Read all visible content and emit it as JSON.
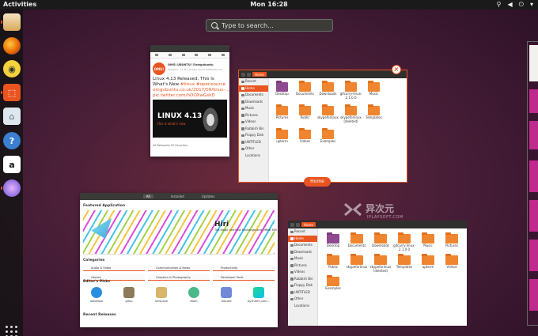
{
  "topbar": {
    "activities": "Activities",
    "clock": "Mon 16:28"
  },
  "search": {
    "placeholder": "Type to search..."
  },
  "dock": {
    "apps": [
      "files-manager-icon",
      "firefox-icon",
      "rhythmbox-icon",
      "software-icon",
      "trash-icon",
      "help-icon",
      "amazon-icon",
      "app-icon"
    ]
  },
  "tweet": {
    "handle": "OMG! UBUNTU! @omgubuntu",
    "date": "09/28/17, 17:46 | Tweets about @OMGUbuntu",
    "text_main": "Linux 4.13 Released, This Is What's New ",
    "tags": "#linux #opensource",
    "link": " omgubuntu.co.uk/2017/09/linux-... pic.twitter.com/hOOXwGskD",
    "image_title": "LINUX 4.13",
    "image_sub": "this is what's new",
    "logo": "OMG!",
    "footer": "46 Retweets  29 Favorites"
  },
  "file_manager": {
    "path": "Home",
    "sidebar": [
      "Recent",
      "Home",
      "Documents",
      "Downloads",
      "Music",
      "Pictures",
      "Videos",
      "Rubbish Bin",
      "Floppy Disk",
      "UNTITLED",
      "Other Locations"
    ],
    "items": [
      "Desktop",
      "Documents",
      "Downloads",
      "gifcurry-linux-2.1.0.0",
      "Music",
      "Pictures",
      "Public",
      "skypeforlinux",
      "skypeforlinux (deleted)",
      "Templates",
      "upterm",
      "Videos",
      "Examples"
    ],
    "items_secondary": [
      "Desktop",
      "Documents",
      "Downloads",
      "gifcurry-linux-2.1.0.0",
      "Music",
      "Pictures",
      "Public",
      "skypeforlinux",
      "skypeforlinux (deleted)",
      "Templates",
      "upterm",
      "Videos",
      "Examples"
    ],
    "close_glyph": "×",
    "overview_label": "Home"
  },
  "software": {
    "tabs": [
      "All",
      "Installed",
      "Updates"
    ],
    "featured_title": "Featured Application",
    "banner_title": "Hiri",
    "banner_sub": "The email client for Exchange and Office 365",
    "categories_title": "Categories",
    "categories": [
      "Audio & Video",
      "Communication & News",
      "Productivity",
      "Games",
      "Graphics & Photography",
      "Developer Tools"
    ],
    "picks_title": "Editor's Picks",
    "picks": [
      "wavebox",
      "gimp",
      "inkscape",
      "atom",
      "discord",
      "pycharm-com..."
    ],
    "recent_title": "Recent Releases"
  },
  "watermark": {
    "brand": "异次元",
    "url": "IPLAYSOFT.COM"
  }
}
